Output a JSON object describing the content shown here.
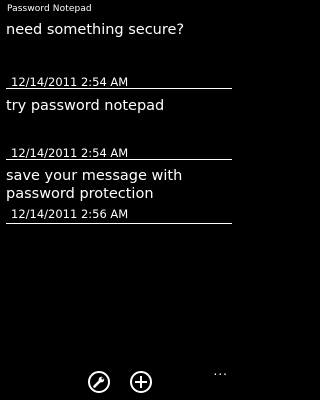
{
  "app": {
    "title": "Password Notepad"
  },
  "notes": [
    {
      "text_lines": [
        "need something secure?"
      ],
      "date": "12/14/2011 2:54 AM"
    },
    {
      "text_lines": [
        "try password notepad"
      ],
      "date": "12/14/2011 2:54 AM"
    },
    {
      "text_lines": [
        "save your message with",
        "password protection"
      ],
      "date": "12/14/2011 2:56 AM"
    }
  ],
  "appbar": {
    "buttons": [
      {
        "icon": "wrench-icon"
      },
      {
        "icon": "plus-icon"
      }
    ],
    "more": "..."
  },
  "colors": {
    "background": "#000000",
    "foreground": "#ffffff"
  }
}
